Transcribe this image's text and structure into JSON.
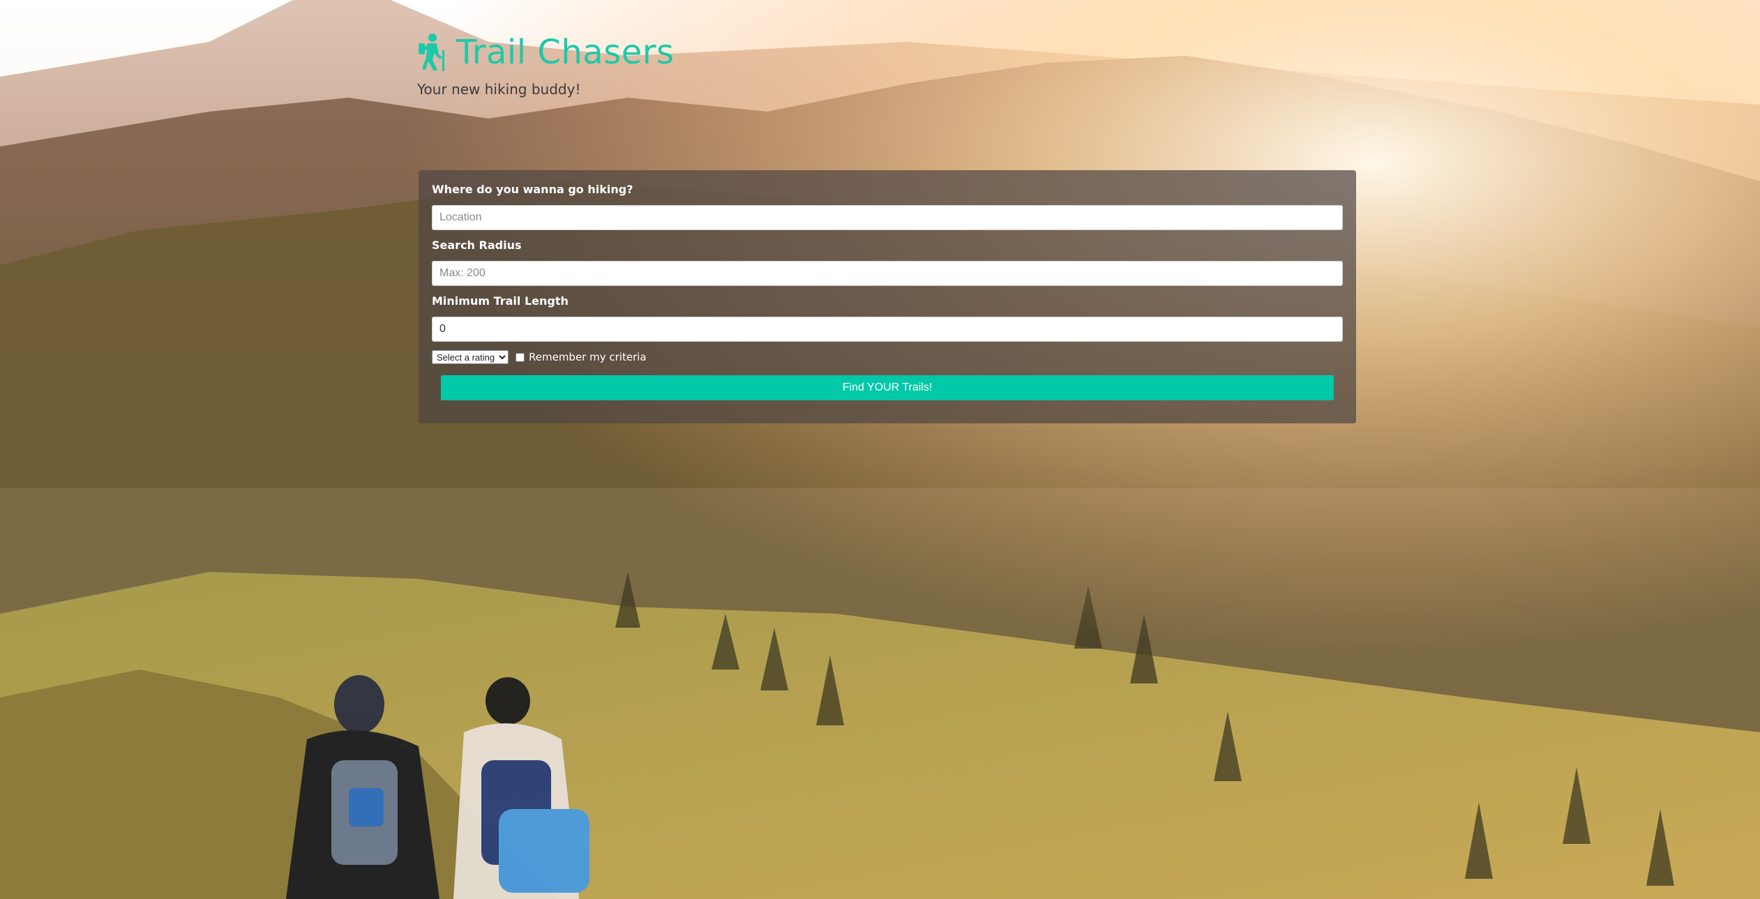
{
  "header": {
    "title": "Trail Chasers",
    "subtitle": "Your new hiking buddy!",
    "icon": "hiker-icon",
    "accent_color": "#1ec9a8"
  },
  "form": {
    "location_label": "Where do you wanna go hiking?",
    "location_placeholder": "Location",
    "location_value": "",
    "radius_label": "Search Radius",
    "radius_placeholder": "Max: 200",
    "radius_value": "",
    "min_length_label": "Minimum Trail Length",
    "min_length_value": "0",
    "rating_select_value": "Select a rating",
    "remember_label": "Remember my criteria",
    "remember_checked": false,
    "submit_label": "Find YOUR Trails!",
    "submit_color": "#01c9a8"
  }
}
